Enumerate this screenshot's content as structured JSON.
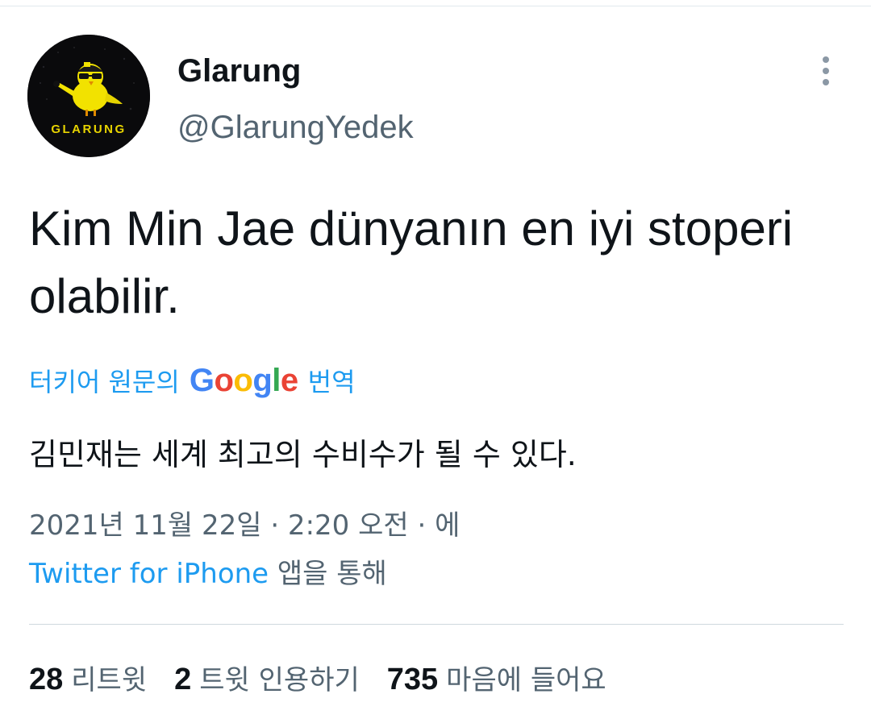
{
  "tweet": {
    "display_name": "Glarung",
    "handle": "@GlarungYedek",
    "avatar_text": "GLARUNG",
    "text": "Kim Min Jae dünyanın en iyi stoperi olabilir.",
    "translation": {
      "label": "터키어 원문의",
      "provider": "Google",
      "suffix": "번역",
      "text": "김민재는 세계 최고의 수비수가 될 수 있다."
    },
    "timestamp": "2021년 11월 22일 · 2:20 오전 · 에",
    "source": {
      "app": "Twitter for iPhone",
      "suffix": "앱을 통해"
    },
    "stats": {
      "retweets": {
        "count": "28",
        "label": "리트윗"
      },
      "quotes": {
        "count": "2",
        "label": "트윗 인용하기"
      },
      "likes": {
        "count": "735",
        "label": "마음에 들어요"
      }
    }
  },
  "icons": {
    "more": "more-vertical-icon",
    "avatar": "bird-avatar-icon"
  },
  "colors": {
    "link_blue": "#1d9bf0",
    "text_primary": "#0f1419",
    "text_secondary": "#536471",
    "divider": "#cfd9de",
    "avatar_bg": "#0a0a0c",
    "avatar_bird": "#f2e200"
  }
}
